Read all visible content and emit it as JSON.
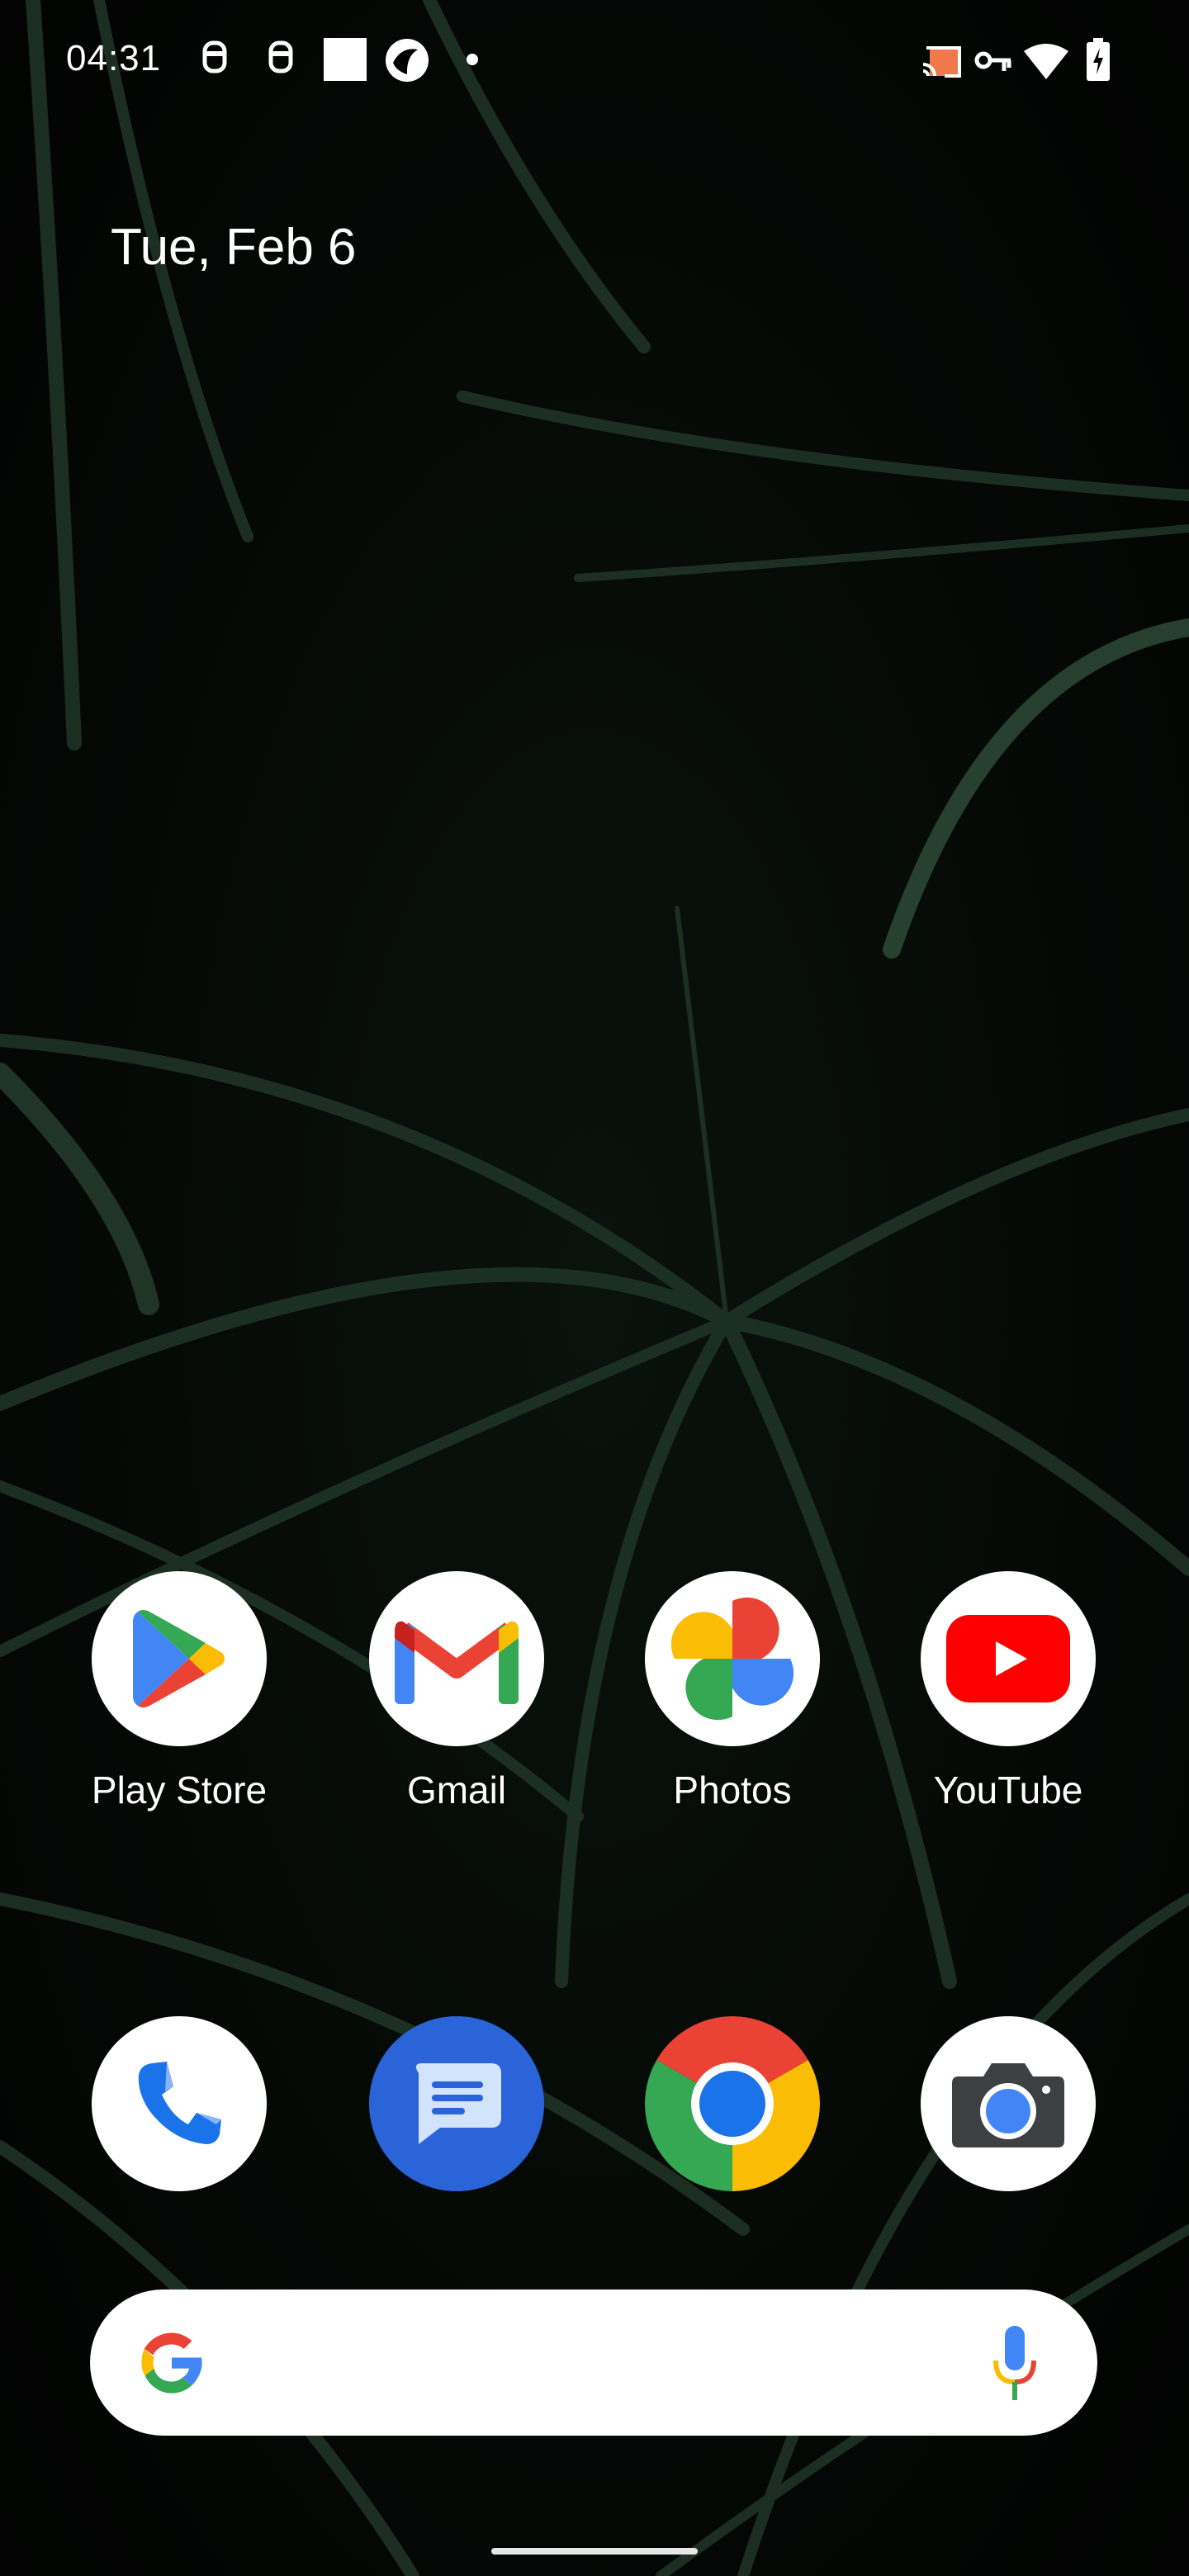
{
  "status_bar": {
    "time": "04:31",
    "left_icons": [
      "notification-robot-icon",
      "notification-robot-icon",
      "white-square-icon",
      "shutter-app-icon",
      "more-notifications-dot-icon"
    ],
    "right_icons": [
      "cast-icon",
      "vpn-key-icon",
      "wifi-icon",
      "battery-charging-icon"
    ],
    "cast_color": "#f0784a"
  },
  "widget": {
    "date": "Tue, Feb 6"
  },
  "apps": [
    {
      "label": "Play Store",
      "icon": "play-store-icon"
    },
    {
      "label": "Gmail",
      "icon": "gmail-icon"
    },
    {
      "label": "Photos",
      "icon": "photos-icon"
    },
    {
      "label": "YouTube",
      "icon": "youtube-icon"
    }
  ],
  "dock": [
    {
      "name": "Phone",
      "icon": "phone-icon"
    },
    {
      "name": "Messages",
      "icon": "messages-icon"
    },
    {
      "name": "Chrome",
      "icon": "chrome-icon"
    },
    {
      "name": "Camera",
      "icon": "camera-icon"
    }
  ],
  "search_bar": {
    "left_icon": "google-g-icon",
    "right_icon": "microphone-icon"
  },
  "colors": {
    "google_blue": "#4285f4",
    "google_red": "#ea4335",
    "google_yellow": "#fbbc04",
    "google_green": "#34a853",
    "youtube_red": "#ff0000",
    "messages_blue": "#1a73e8"
  }
}
